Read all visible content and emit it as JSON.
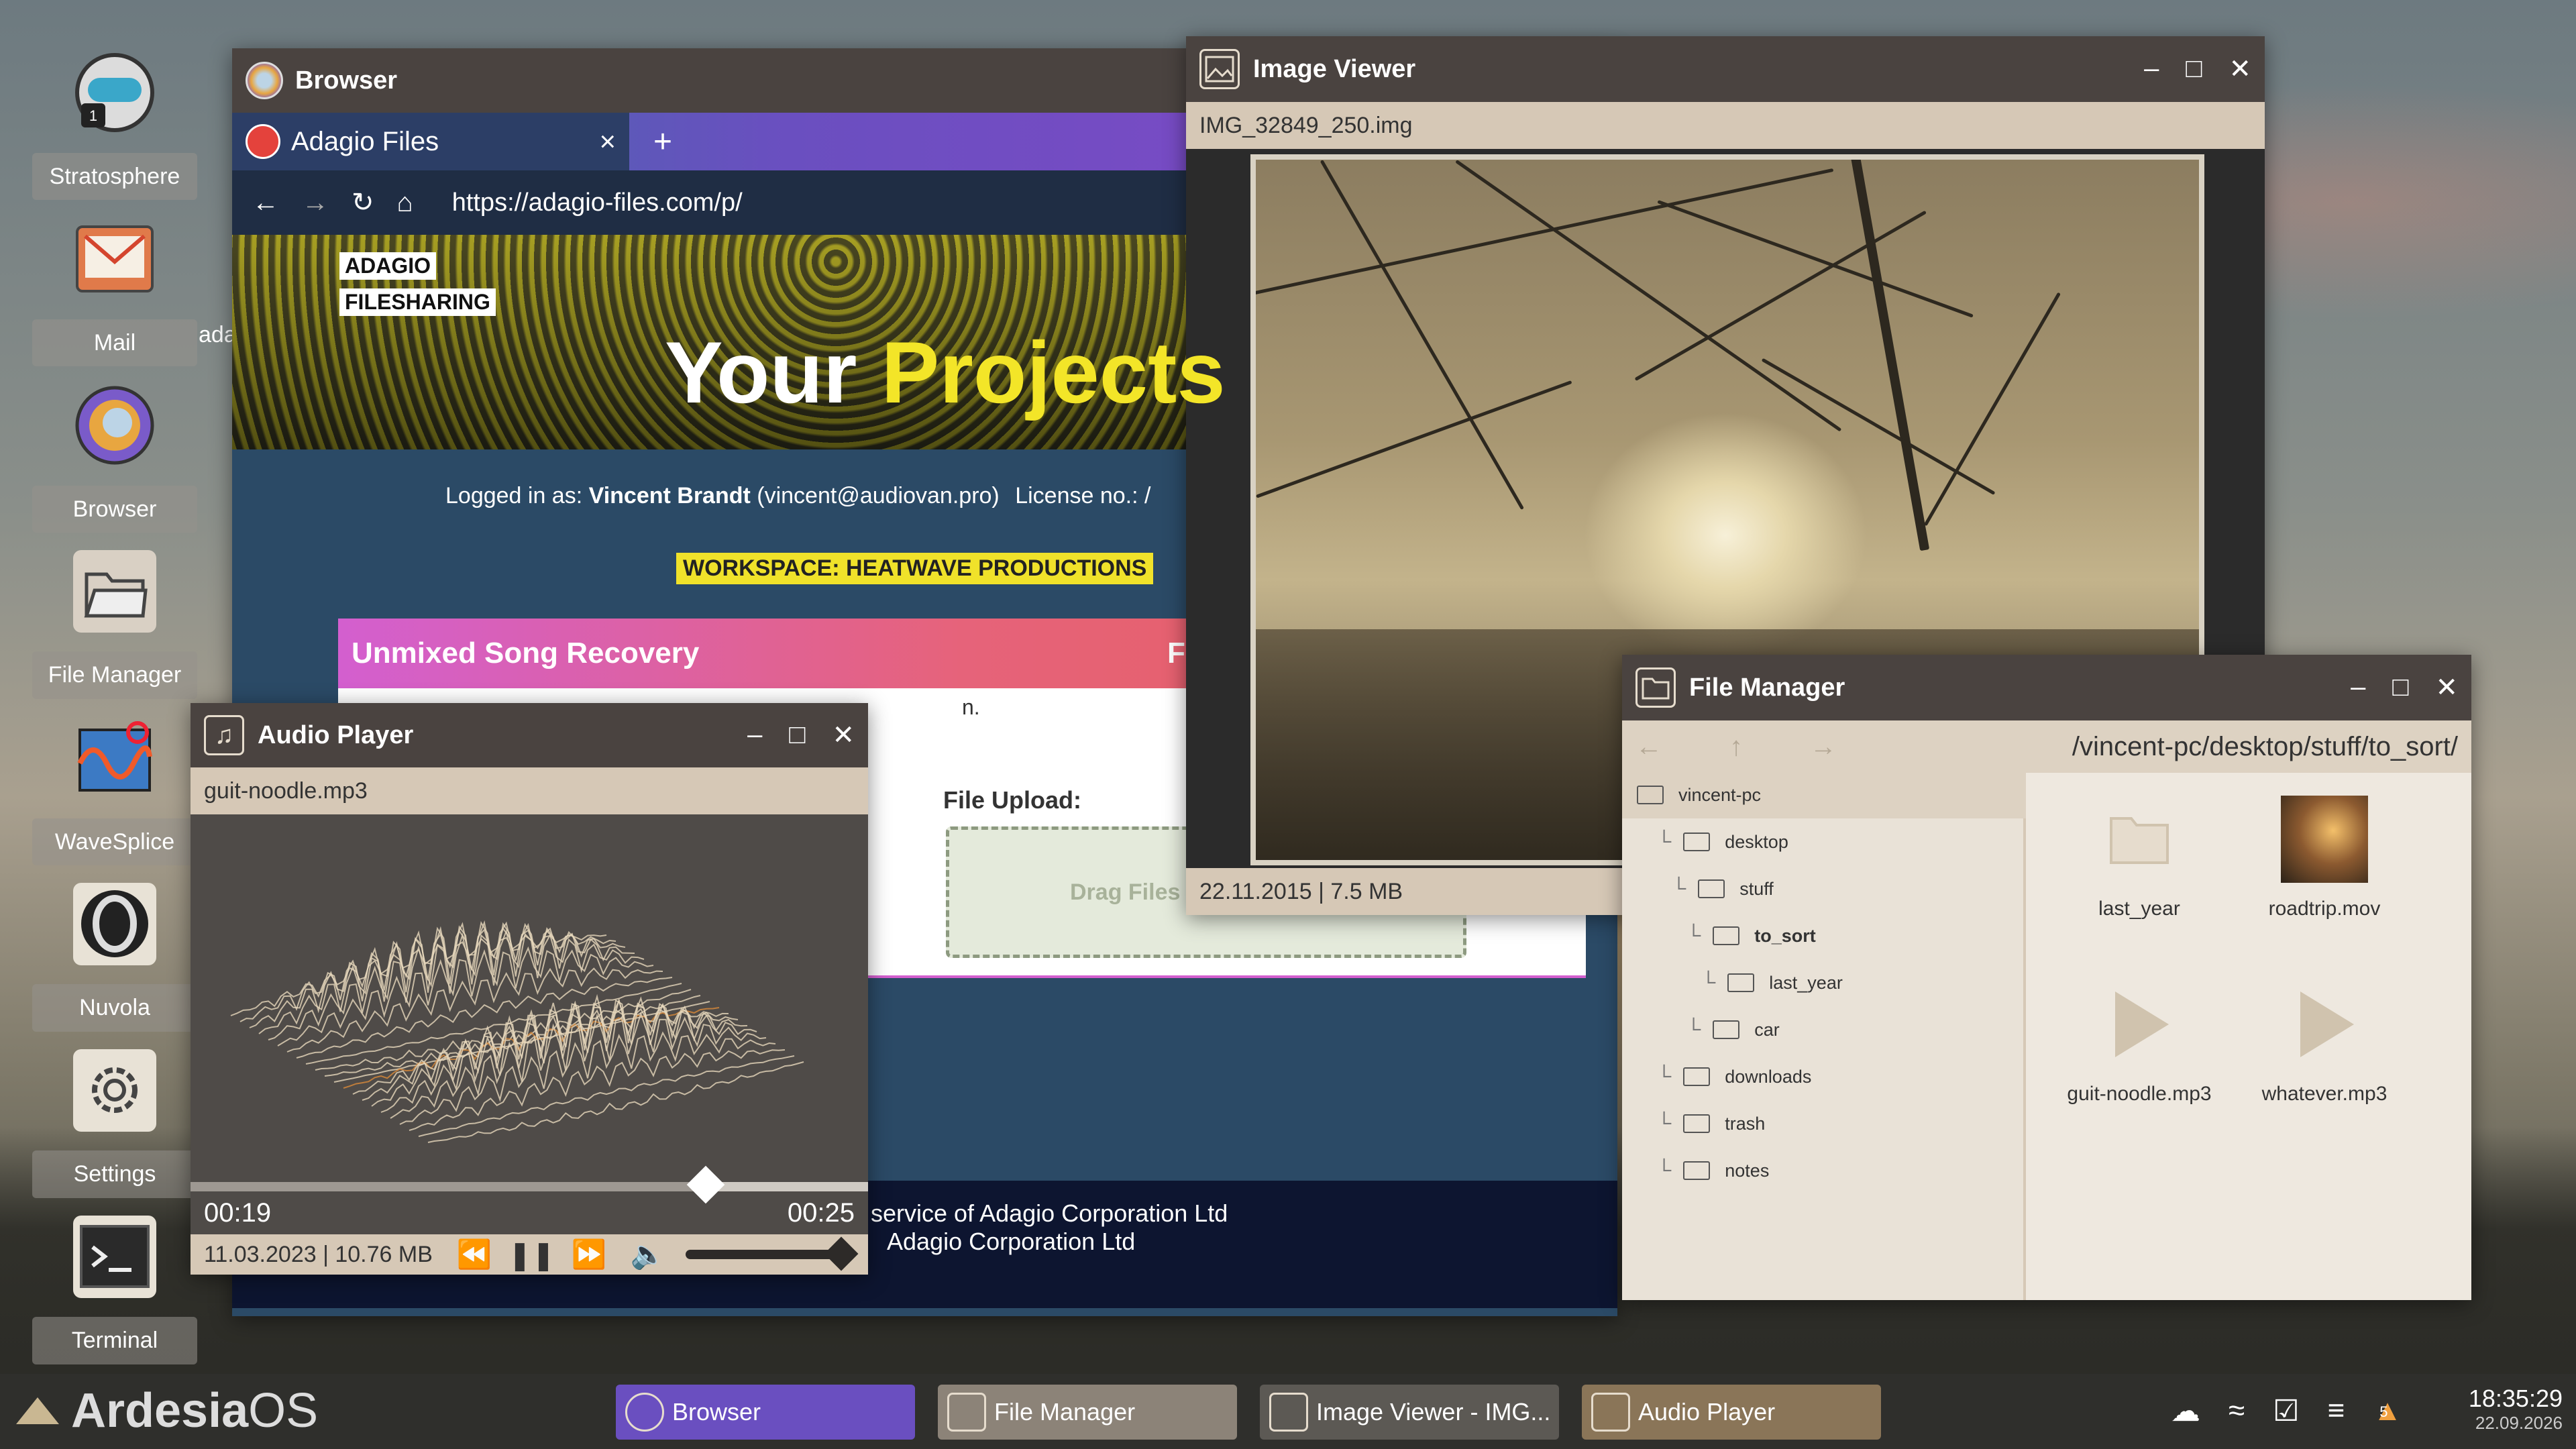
{
  "desktop": {
    "icons": [
      {
        "label": "Stratosphere",
        "icon": "stratosphere-icon",
        "badge": "1"
      },
      {
        "label": "Mail",
        "icon": "mail-icon"
      },
      {
        "label": "Browser",
        "icon": "browser-icon"
      },
      {
        "label": "File Manager",
        "icon": "folder-icon"
      },
      {
        "label": "WaveSplice",
        "icon": "wavesplice-icon"
      },
      {
        "label": "Nuvola",
        "icon": "nuvola-icon"
      },
      {
        "label": "Settings",
        "icon": "gear-icon"
      },
      {
        "label": "Terminal",
        "icon": "terminal-icon"
      }
    ],
    "stray_text": "ada"
  },
  "browser": {
    "title": "Browser",
    "tab_label": "Adagio Files",
    "tab_close": "×",
    "new_tab": "+",
    "url": "https://adagio-files.com/p/",
    "page": {
      "brand_line1": "ADAGIO",
      "brand_line2": "FILESHARING",
      "hero_word1": "Your",
      "hero_word2": "Projects",
      "logged_in_prefix": "Logged in as:",
      "user_name": "Vincent Brandt",
      "user_email": "(vincent@audiovan.pro)",
      "license": "License no.: /",
      "workspace": "WORKSPACE: HEATWAVE PRODUCTIONS",
      "card_title": "Unmixed Song Recovery",
      "card_letter": "F",
      "card_fragment": "n.",
      "upload_label": "File Upload:",
      "drop_text": "Drag Files",
      "footer_line1": "service of Adagio Corporation Ltd",
      "footer_line2": "Adagio Corporation Ltd"
    }
  },
  "image_viewer": {
    "title": "Image Viewer",
    "filename": "IMG_32849_250.img",
    "info": "22.11.2015 | 7.5 MB"
  },
  "file_manager": {
    "title": "File Manager",
    "path": "/vincent-pc/desktop/stuff/to_sort/",
    "tree": [
      {
        "label": "vincent-pc",
        "depth": 0
      },
      {
        "label": "desktop",
        "depth": 1
      },
      {
        "label": "stuff",
        "depth": 2
      },
      {
        "label": "to_sort",
        "depth": 3,
        "selected": true
      },
      {
        "label": "last_year",
        "depth": 4
      },
      {
        "label": "car",
        "depth": 3
      },
      {
        "label": "downloads",
        "depth": 1
      },
      {
        "label": "trash",
        "depth": 1
      },
      {
        "label": "notes",
        "depth": 1
      }
    ],
    "files": [
      {
        "name": "last_year",
        "kind": "folder"
      },
      {
        "name": "roadtrip.mov",
        "kind": "video"
      },
      {
        "name": "guit-noodle.mp3",
        "kind": "audio"
      },
      {
        "name": "whatever.mp3",
        "kind": "audio"
      }
    ]
  },
  "audio_player": {
    "title": "Audio Player",
    "filename": "guit-noodle.mp3",
    "elapsed": "00:19",
    "total": "00:25",
    "progress": 0.76,
    "volume": 1.0,
    "info": "11.03.2023 | 10.76 MB"
  },
  "taskbar": {
    "os_name_a": "Ardesia",
    "os_name_b": "OS",
    "tasks": [
      {
        "label": "Browser",
        "color": "#6a4fc0"
      },
      {
        "label": "File Manager",
        "color": "#8c8378"
      },
      {
        "label": "Image Viewer - IMG...",
        "color": "#5c5954"
      },
      {
        "label": "Audio Player",
        "color": "#8a7558"
      }
    ],
    "time": "18:35:29",
    "date": "22.09.2026",
    "notification_count": "5"
  }
}
